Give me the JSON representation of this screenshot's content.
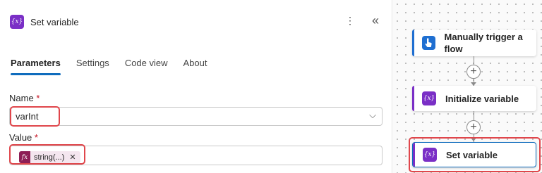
{
  "panel": {
    "title": "Set variable",
    "icon": "variable-icon",
    "icon_text": "{x}",
    "more_icon": "more-vertical-icon",
    "more_glyph": "⋮",
    "collapse_icon": "collapse-left-icon",
    "collapse_glyph": "«"
  },
  "tabs": [
    {
      "label": "Parameters",
      "active": true
    },
    {
      "label": "Settings",
      "active": false
    },
    {
      "label": "Code view",
      "active": false
    },
    {
      "label": "About",
      "active": false
    }
  ],
  "form": {
    "name_label": "Name",
    "name_value": "varInt",
    "name_chevron": "⌵",
    "value_label": "Value",
    "required_mark": "*",
    "value_token": {
      "icon_text": "fx",
      "label": "string(...)",
      "remove": "✕"
    }
  },
  "flow": {
    "plus_glyph": "+",
    "steps": [
      {
        "label": "Manually trigger a flow",
        "icon": "hand-touch-icon",
        "color": "#1f6fd1"
      },
      {
        "label": "Initialize variable",
        "icon": "variable-icon",
        "color": "#7a2fc6"
      },
      {
        "label": "Set variable",
        "icon": "variable-icon",
        "color": "#7a2fc6",
        "selected": true
      }
    ]
  },
  "colors": {
    "accent": "#0f6cbd",
    "variable": "#7a2fc6",
    "highlight": "#e0464b",
    "expression": "#8e1f56"
  }
}
